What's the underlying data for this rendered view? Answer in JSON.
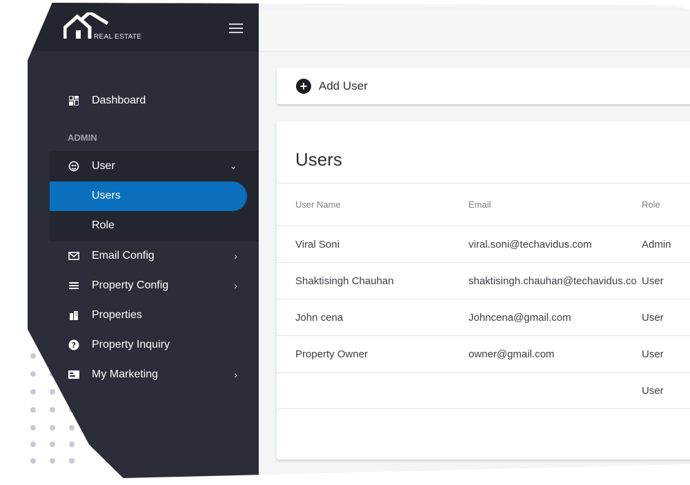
{
  "brand": {
    "name": "REAL ESTATE"
  },
  "sidebar": {
    "section_label": "ADMIN",
    "items": [
      {
        "label": "Dashboard",
        "icon": "dashboard-icon"
      },
      {
        "label": "User",
        "icon": "user-icon"
      },
      {
        "label": "Users"
      },
      {
        "label": "Role"
      },
      {
        "label": "Email Config",
        "icon": "mail-icon"
      },
      {
        "label": "Property Config",
        "icon": "list-icon"
      },
      {
        "label": "Properties",
        "icon": "building-icon"
      },
      {
        "label": "Property Inquiry",
        "icon": "help-icon"
      },
      {
        "label": "My Marketing",
        "icon": "card-icon"
      }
    ]
  },
  "toolbar": {
    "add_user_label": "Add User"
  },
  "users": {
    "title": "Users",
    "columns": [
      "User Name",
      "Email",
      "Role"
    ],
    "rows": [
      [
        "Viral Soni",
        "viral.soni@techavidus.com",
        "Admin"
      ],
      [
        "Shaktisingh Chauhan",
        "shaktisingh.chauhan@techavidus.co",
        "User"
      ],
      [
        "John cena",
        "Johncena@gmail.com",
        "User"
      ],
      [
        "Property Owner",
        "owner@gmail.com",
        "User"
      ],
      [
        "",
        "",
        "User"
      ]
    ]
  },
  "colors": {
    "sidebar": "#2b2e38",
    "accent": "#0a6fbd"
  }
}
